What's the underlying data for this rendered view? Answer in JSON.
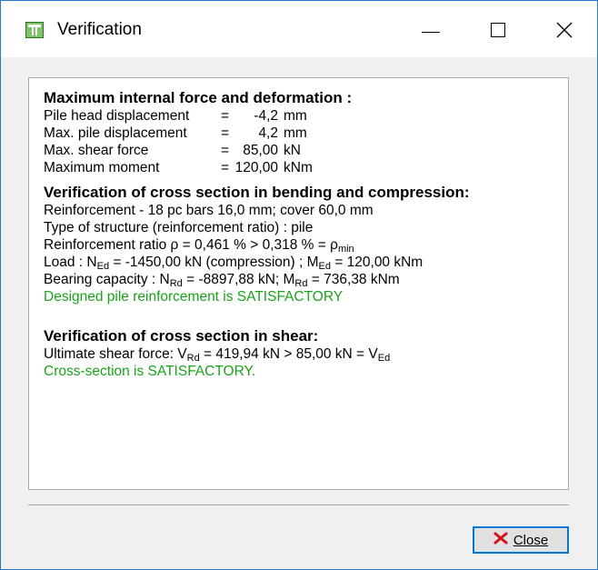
{
  "window": {
    "title": "Verification",
    "icon": "pile-app-icon"
  },
  "section1": {
    "heading": "Maximum internal force and deformation :",
    "rows": [
      {
        "label": "Pile head displacement",
        "eq": "=",
        "value": "-4,2",
        "unit": "mm"
      },
      {
        "label": "Max. pile displacement",
        "eq": "=",
        "value": "4,2",
        "unit": "mm"
      },
      {
        "label": "Max. shear force",
        "eq": "=",
        "value": "85,00",
        "unit": "kN"
      },
      {
        "label": "Maximum moment",
        "eq": "=",
        "value": "120,00",
        "unit": "kNm"
      }
    ]
  },
  "section2": {
    "heading": "Verification of cross section in bending and compression:",
    "reinforcement": "Reinforcement - 18 pc bars 16,0 mm; cover 60,0 mm",
    "structure_type": "Type of structure (reinforcement ratio) : pile",
    "ratio": {
      "prefix": "Reinforcement ratio ρ = 0,461 % > 0,318 % = ρ",
      "sub": "min"
    },
    "load": {
      "p1": "Load : N",
      "s1": "Ed",
      "p2": " = -1450,00 kN (compression) ; M",
      "s2": "Ed",
      "p3": " = 120,00 kNm"
    },
    "capacity": {
      "p1": "Bearing capacity : N",
      "s1": "Rd",
      "p2": " = -8897,88 kN; M",
      "s2": "Rd",
      "p3": " = 736,38 kNm"
    },
    "result": "Designed pile reinforcement is SATISFACTORY"
  },
  "section3": {
    "heading": "Verification of cross section in shear:",
    "shear": {
      "p1": "Ultimate shear force: V",
      "s1": "Rd",
      "p2": " = 419,94 kN > 85,00 kN = V",
      "s2": "Ed"
    },
    "result": "Cross-section is SATISFACTORY."
  },
  "buttons": {
    "close_label": "Close"
  },
  "colors": {
    "satisfactory": "#1aa21a",
    "focus_border": "#0078d7",
    "close_icon": "#d0121b"
  }
}
